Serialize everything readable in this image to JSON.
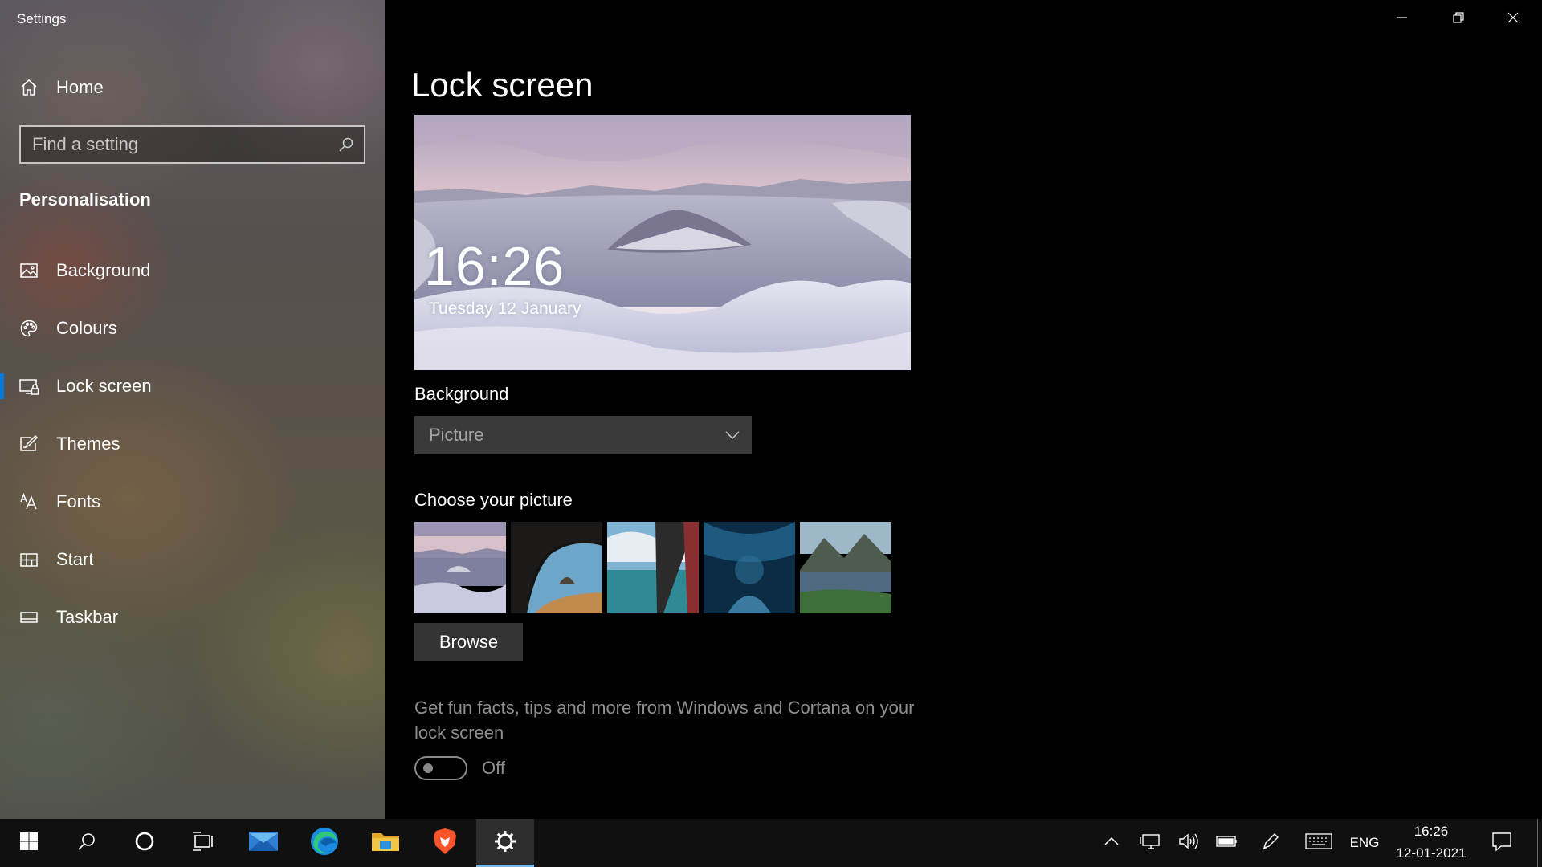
{
  "app": {
    "title": "Settings"
  },
  "sidebar": {
    "home_label": "Home",
    "search_placeholder": "Find a setting",
    "section_title": "Personalisation",
    "items": [
      {
        "label": "Background",
        "icon": "picture-icon"
      },
      {
        "label": "Colours",
        "icon": "palette-icon"
      },
      {
        "label": "Lock screen",
        "icon": "lock-screen-icon",
        "active": true
      },
      {
        "label": "Themes",
        "icon": "themes-icon"
      },
      {
        "label": "Fonts",
        "icon": "fonts-icon"
      },
      {
        "label": "Start",
        "icon": "start-icon"
      },
      {
        "label": "Taskbar",
        "icon": "taskbar-icon"
      }
    ]
  },
  "main": {
    "title": "Lock screen",
    "preview": {
      "time": "16:26",
      "date": "Tuesday 12 January"
    },
    "background_label": "Background",
    "background_value": "Picture",
    "choose_label": "Choose your picture",
    "browse_label": "Browse",
    "tips_text": "Get fun facts, tips and more from Windows and Cortana on your lock screen",
    "tips_toggle_label": "Off",
    "tips_toggle_on": false
  },
  "taskbar": {
    "apps": [
      "start-icon",
      "search-icon",
      "cortana-icon",
      "task-view-icon",
      "mail-icon",
      "edge-icon",
      "file-explorer-icon",
      "brave-icon",
      "settings-icon"
    ],
    "active_app": "settings-icon",
    "tray_icons": [
      "chevron-up-icon",
      "network-icon",
      "volume-icon",
      "battery-icon",
      "pen-icon",
      "touch-keyboard-icon"
    ],
    "language": "ENG",
    "time": "16:26",
    "date": "12-01-2021"
  },
  "colors": {
    "accent": "#0a78d7",
    "taskbar_active_underline": "#76b9ed"
  }
}
